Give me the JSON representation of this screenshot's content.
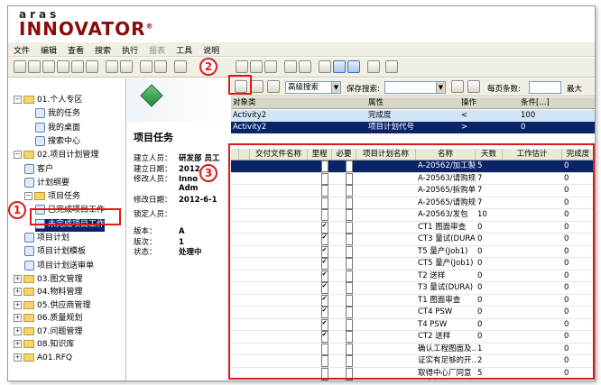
{
  "logo": {
    "line1": "aras",
    "line2": "INNOVATOR",
    "reg": "®"
  },
  "menu": [
    {
      "label": "文件",
      "enabled": true
    },
    {
      "label": "编辑",
      "enabled": true
    },
    {
      "label": "查看",
      "enabled": true
    },
    {
      "label": "搜索",
      "enabled": true
    },
    {
      "label": "执行",
      "enabled": true
    },
    {
      "label": "报表",
      "enabled": false
    },
    {
      "label": "工具",
      "enabled": true
    },
    {
      "label": "说明",
      "enabled": true
    }
  ],
  "tree": [
    {
      "label": "01.个人专区",
      "level": 0,
      "kind": "folder",
      "exp": "−"
    },
    {
      "label": "我的任务",
      "level": 2,
      "kind": "item"
    },
    {
      "label": "我的桌面",
      "level": 2,
      "kind": "item"
    },
    {
      "label": "搜索中心",
      "level": 2,
      "kind": "item"
    },
    {
      "label": "02.项目计划管理",
      "level": 0,
      "kind": "folder",
      "exp": "−"
    },
    {
      "label": "客户",
      "level": 1,
      "kind": "item"
    },
    {
      "label": "计划纲要",
      "level": 1,
      "kind": "item"
    },
    {
      "label": "项目任务",
      "level": 1,
      "kind": "folder",
      "exp": "−"
    },
    {
      "label": "已完成项目工作",
      "level": 2,
      "kind": "item"
    },
    {
      "label": "未完成项目工作",
      "level": 2,
      "kind": "item",
      "selected": true
    },
    {
      "label": "项目计划",
      "level": 1,
      "kind": "item"
    },
    {
      "label": "项目计划模板",
      "level": 1,
      "kind": "item"
    },
    {
      "label": "项目计划送审单",
      "level": 1,
      "kind": "item"
    },
    {
      "label": "03.图文管理",
      "level": 0,
      "kind": "folder",
      "exp": "+"
    },
    {
      "label": "04.物料管理",
      "level": 0,
      "kind": "folder",
      "exp": "+"
    },
    {
      "label": "05.供应商管理",
      "level": 0,
      "kind": "folder",
      "exp": "+"
    },
    {
      "label": "06.质量规划",
      "level": 0,
      "kind": "folder",
      "exp": "+"
    },
    {
      "label": "07.问题管理",
      "level": 0,
      "kind": "folder",
      "exp": "+"
    },
    {
      "label": "08.知识库",
      "level": 0,
      "kind": "folder",
      "exp": "+"
    },
    {
      "label": "A01.RFQ",
      "level": 0,
      "kind": "folder",
      "exp": "+"
    }
  ],
  "detail": {
    "title": "项目任务",
    "props": [
      {
        "k": "建立人员：",
        "v": "研发部 员工"
      },
      {
        "k": "建立日期：",
        "v": "2012"
      },
      {
        "k": "修改人员：",
        "v": "Inno"
      },
      {
        "k": "",
        "v": "Adm"
      },
      {
        "k": "修改日期：",
        "v": "2012-6-1"
      },
      {
        "k": "锁定人员：",
        "v": ""
      },
      {
        "k": "版本：",
        "v": "A"
      },
      {
        "k": "版次：",
        "v": "1"
      },
      {
        "k": "状态：",
        "v": "处理中"
      }
    ]
  },
  "search_toolbar": {
    "mode": "高级搜索",
    "save_label": "保存搜索:",
    "page_label": "每页条数:",
    "max_label": "最大"
  },
  "search_criteria": {
    "headers": [
      "对象类",
      "属性",
      "操作",
      "条件[...]"
    ],
    "rows": [
      {
        "cls": "Activity2",
        "attr": "完成度",
        "op": "<",
        "val": "100",
        "state": "active"
      },
      {
        "cls": "Activity2",
        "attr": "项目计划代号",
        "op": ">",
        "val": "0",
        "state": "selected"
      }
    ]
  },
  "grid": {
    "headers": [
      "",
      "",
      "交付文件名称",
      "里程",
      "必要",
      "项目计划名称",
      "名称",
      "天数",
      "工作估计",
      "完成度"
    ],
    "rows": [
      {
        "deliv": "",
        "mile": false,
        "req": false,
        "plan": "",
        "name": "A-20562/加工製作",
        "days": "5",
        "est": "",
        "done": "0",
        "hl": true
      },
      {
        "deliv": "",
        "mile": false,
        "req": false,
        "plan": "",
        "name": "A-20563/请购规格",
        "days": "7",
        "est": "",
        "done": "0"
      },
      {
        "deliv": "",
        "mile": false,
        "req": false,
        "plan": "",
        "name": "A-20565/拆购单...",
        "days": "7",
        "est": "",
        "done": "0"
      },
      {
        "deliv": "",
        "mile": false,
        "req": false,
        "plan": "",
        "name": "A-20565/请购规格",
        "days": "7",
        "est": "",
        "done": "0"
      },
      {
        "deliv": "",
        "mile": false,
        "req": false,
        "plan": "",
        "name": "A-20563/发包",
        "days": "10",
        "est": "",
        "done": "0"
      },
      {
        "deliv": "",
        "mile": true,
        "req": false,
        "plan": "",
        "name": "CT1 图面审查",
        "days": "0",
        "est": "",
        "done": "0"
      },
      {
        "deliv": "",
        "mile": true,
        "req": false,
        "plan": "",
        "name": "CT3 量试(DURA)",
        "days": "0",
        "est": "",
        "done": "0"
      },
      {
        "deliv": "",
        "mile": true,
        "req": false,
        "plan": "",
        "name": "T5 量产(Job1)",
        "days": "0",
        "est": "",
        "done": "0"
      },
      {
        "deliv": "",
        "mile": true,
        "req": false,
        "plan": "",
        "name": "CT5 量产(Job1)",
        "days": "0",
        "est": "",
        "done": "0"
      },
      {
        "deliv": "",
        "mile": true,
        "req": false,
        "plan": "",
        "name": "T2 送样",
        "days": "0",
        "est": "",
        "done": "0"
      },
      {
        "deliv": "",
        "mile": true,
        "req": false,
        "plan": "",
        "name": "T3 量试(DURA)",
        "days": "0",
        "est": "",
        "done": "0"
      },
      {
        "deliv": "",
        "mile": true,
        "req": false,
        "plan": "",
        "name": "T1 图面审查",
        "days": "0",
        "est": "",
        "done": "0"
      },
      {
        "deliv": "",
        "mile": true,
        "req": false,
        "plan": "",
        "name": "CT4 PSW",
        "days": "0",
        "est": "",
        "done": "0"
      },
      {
        "deliv": "",
        "mile": true,
        "req": false,
        "plan": "",
        "name": "T4 PSW",
        "days": "0",
        "est": "",
        "done": "0"
      },
      {
        "deliv": "",
        "mile": true,
        "req": false,
        "plan": "",
        "name": "CT2 送样",
        "days": "0",
        "est": "",
        "done": "0"
      },
      {
        "deliv": "",
        "mile": false,
        "req": false,
        "plan": "",
        "name": "确认工程图面及...",
        "days": "1",
        "est": "",
        "done": "0"
      },
      {
        "deliv": "",
        "mile": false,
        "req": false,
        "plan": "",
        "name": "证实有足够的开...",
        "days": "2",
        "est": "",
        "done": "0"
      },
      {
        "deliv": "",
        "mile": false,
        "req": false,
        "plan": "",
        "name": "取得中心厂同意",
        "days": "5",
        "est": "",
        "done": "0"
      },
      {
        "deliv": "",
        "mile": false,
        "req": false,
        "plan": "",
        "name": "开发起始暨品质...",
        "days": "1",
        "est": "",
        "done": "0"
      }
    ]
  },
  "callouts": [
    "1",
    "2",
    "3"
  ]
}
